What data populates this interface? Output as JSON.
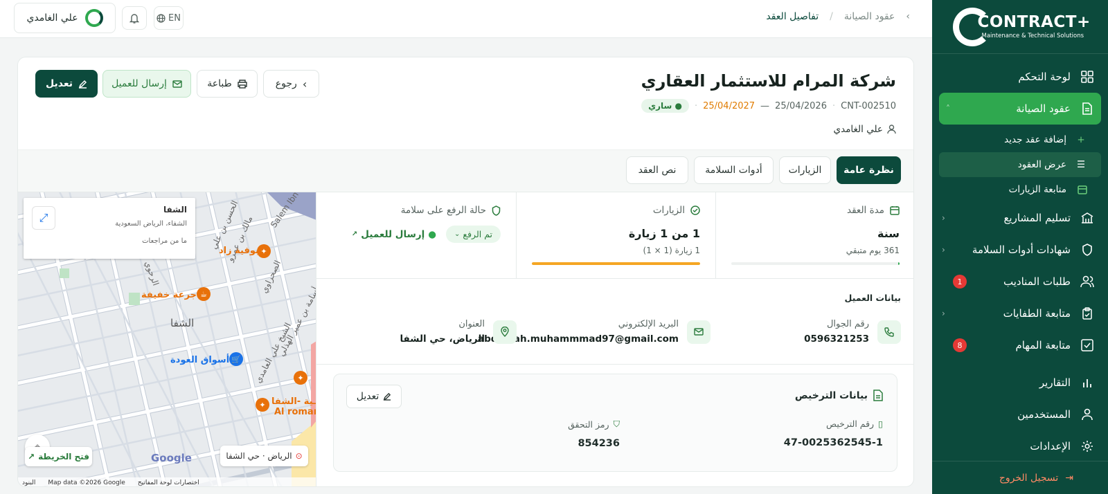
{
  "brand": {
    "name": "CONTRACT+",
    "subtitle": "Maintenance & Technical Solutions"
  },
  "sidebar": {
    "dashboard": "لوحة التحكم",
    "maintenance_contracts": "عقود الصيانة",
    "add_contract": "إضافة عقد جديد",
    "view_contracts": "عرض العقود",
    "visits_followup": "متابعة الزيارات",
    "project_delivery": "تسليم المشاريع",
    "safety_certs": "شهادات أدوات السلامة",
    "rep_requests": "طلبات المناديب",
    "rep_requests_badge": "1",
    "extinguishers": "متابعة الطفايات",
    "tasks": "متابعة المهام",
    "tasks_badge": "8",
    "reports": "التقارير",
    "users": "المستخدمين",
    "settings": "الإعدادات",
    "logout": "تسجيل الخروج"
  },
  "topbar": {
    "user_name": "علي الغامدي",
    "lang": "EN",
    "breadcrumb_parent": "عقود الصيانة",
    "breadcrumb_sep": "/",
    "breadcrumb_current": "تفاصيل العقد"
  },
  "contract": {
    "title": "شركة المرام للاستثمار العقاري",
    "code": "CNT-002510",
    "start_date": "25/04/2026",
    "date_sep": "—",
    "end_date": "25/04/2027",
    "status": "● ساري",
    "owner": "علي الغامدي"
  },
  "actions": {
    "back": "رجوع",
    "print": "طباعة",
    "send": "إرسال للعميل",
    "edit": "تعديل"
  },
  "tabs": [
    "نظرة عامة",
    "الزيارات",
    "أدوات السلامة",
    "نص العقد"
  ],
  "stats": {
    "duration": {
      "label": "مدة العقد",
      "value": "سنة",
      "sub": "361 يوم متبقي",
      "progress": 0.01
    },
    "visits": {
      "label": "الزيارات",
      "value": "1 من 1 زيارة",
      "sub": "1 زيارة (1 × 1)",
      "progress": 1.0
    },
    "upload": {
      "label": "حالة الرفع على سلامة",
      "state": "تم الرفع",
      "send": "إرسال للعميل"
    }
  },
  "client": {
    "title": "بيانات العميل",
    "phone_label": "رقم الجوال",
    "phone": "0596321253",
    "email_label": "البريد الإلكتروني",
    "email": "abdulllah.muhammmad97@gmail.com",
    "address_label": "العنوان",
    "address": "الرياض، حي الشفا"
  },
  "license": {
    "title": "بيانات الترخيص",
    "edit": "تعديل",
    "number_label": "رقم الترخيص",
    "number": "47-0025362545-1",
    "verify_label": "رمز التحقق",
    "verify": "854236"
  },
  "map": {
    "info_title": "الشفا",
    "info_sub": "الشفاء، الرياض السعودية",
    "info_reviews": "ما من مراجعات",
    "district": "الشفا",
    "poi_1": "بوفية زاد",
    "poi_2": "جرعة خفيفة",
    "poi_3": "أسواق العودة",
    "poi_4": "ـية -الشفا",
    "poi_5": "Al romar",
    "street_1": "الحسن بن علي",
    "street_2": "مالك بن عمرو",
    "street_3": "Salem Ibn",
    "street_4": "الصحراوي",
    "street_5": "الرحوي",
    "street_6": "أسامة بن عمير الهذلي",
    "street_7": "الشيخ علي العامدي",
    "location_chip": "الرياض · حي الشفا",
    "open_map": "فتح الخريطة",
    "google": "Google",
    "attrib_1": "Map data ©2026 Google",
    "attrib_2": "اختصارات لوحة المفاتيح",
    "attrib_3": "البنود"
  },
  "colors": {
    "primary": "#0c4a3c",
    "accent": "#2fa84f",
    "warning": "#f5a623",
    "danger": "#e53935"
  }
}
